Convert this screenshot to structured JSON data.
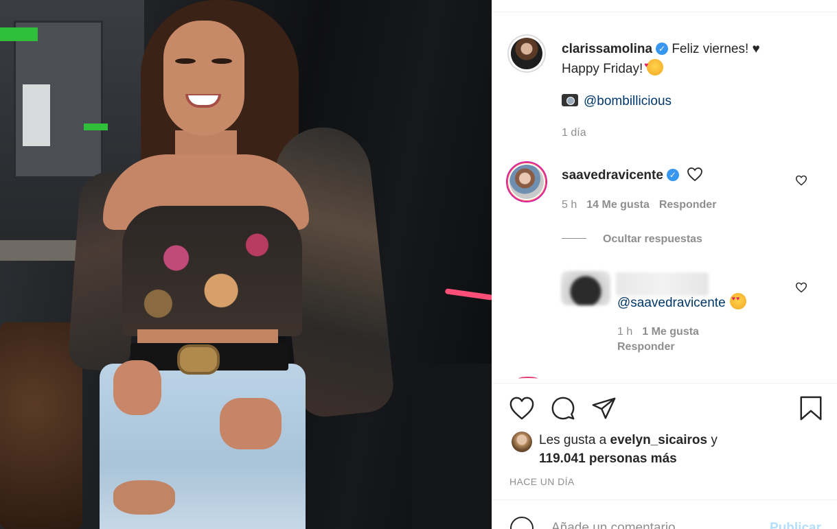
{
  "post": {
    "author": "clarissamolina",
    "caption_line1": "Feliz viernes! ♥",
    "caption_line2": "Happy Friday!",
    "photo_credit": "@bombillicious",
    "posted_ago": "1 día"
  },
  "comments": [
    {
      "username": "saavedravicente",
      "time": "5 h",
      "likes": "14 Me gusta",
      "reply_label": "Responder"
    }
  ],
  "hide_replies_label": "Ocultar respuestas",
  "reply": {
    "text": "@saavedravicente",
    "time": "1 h",
    "likes": "1 Me gusta",
    "reply_label": "Responder"
  },
  "likes": {
    "prefix": "Les gusta a ",
    "first_user": "evelyn_sicairos",
    "suffix": " y",
    "others": "119.041 personas más"
  },
  "timestamp": "HACE UN DÍA",
  "comment_box": {
    "placeholder": "Añade un comentario...",
    "post_label": "Publicar"
  },
  "icons": {
    "verified": "verified-badge-icon",
    "like": "heart-icon",
    "comment": "comment-bubble-icon",
    "share": "paper-plane-icon",
    "save": "bookmark-icon",
    "emoji": "smiley-icon"
  },
  "colors": {
    "link": "#00376b",
    "muted": "#8e8e8e",
    "verified": "#3897f0",
    "publish_disabled": "#b2dffc"
  }
}
